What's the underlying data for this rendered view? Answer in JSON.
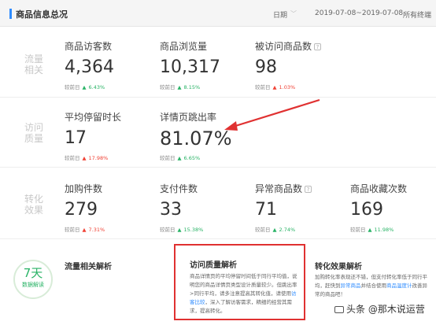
{
  "header": {
    "title": "商品信息总况",
    "date_label": "日期",
    "date_range": "2019-07-08~2019-07-08",
    "terminal": "所有终端"
  },
  "sections": {
    "traffic": [
      "流量",
      "相关"
    ],
    "visit": [
      "访问",
      "质量"
    ],
    "conversion": [
      "转化",
      "效果"
    ]
  },
  "compare_label": "较前日",
  "metrics": {
    "visitors": {
      "name": "商品访客数",
      "value": "4,364",
      "change": "6.43%",
      "direction": "up"
    },
    "pageviews": {
      "name": "商品浏览量",
      "value": "10,317",
      "change": "8.15%",
      "direction": "up"
    },
    "visited_items": {
      "name": "被访问商品数",
      "value": "98",
      "change": "1.03%",
      "direction": "up"
    },
    "avg_stay": {
      "name": "平均停留时长",
      "value": "17",
      "change": "17.98%",
      "direction": "up"
    },
    "bounce_rate": {
      "name": "详情页跳出率",
      "value": "81.07%",
      "change": "6.65%",
      "direction": "up"
    },
    "cart_items": {
      "name": "加购件数",
      "value": "279",
      "change": "7.31%",
      "direction": "up"
    },
    "paid_items": {
      "name": "支付件数",
      "value": "33",
      "change": "15.38%",
      "direction": "up"
    },
    "abnormal_items": {
      "name": "异常商品数",
      "value": "71",
      "change": "2.74%",
      "direction": "up"
    },
    "favorites": {
      "name": "商品收藏次数",
      "value": "169",
      "change": "11.98%",
      "direction": "up"
    }
  },
  "seven_days": {
    "num": "7天",
    "label": "数据解读"
  },
  "analysis": {
    "traffic_title": "流量相关解析",
    "quality_title": "访问质量解析",
    "quality_body_1": "商品详情页的平均停留时间低于同行平均值，说明您的商品详情页类型设计质量较少。但跳出率>同行平均，请多注意提高其转化值，请使用",
    "quality_link": "访客比较",
    "quality_body_2": "，深入了解访客需求，精细的经营其需求，提高转化。",
    "conversion_title": "转化效果解析",
    "conversion_body_1": "加购转化率表现还不错，但支付转化率低于同行平均，赶快到",
    "conversion_link_1": "异常商品",
    "conversion_body_2": "并结合使用",
    "conversion_link_2": "商品温度计",
    "conversion_body_3": "改善异常的商品吧！"
  },
  "watermark": "头条 @那木说运营",
  "colors": {
    "accent": "#2f8cff",
    "up_green": "#29b366",
    "up_red": "#f04134",
    "highlight": "#e03131"
  }
}
